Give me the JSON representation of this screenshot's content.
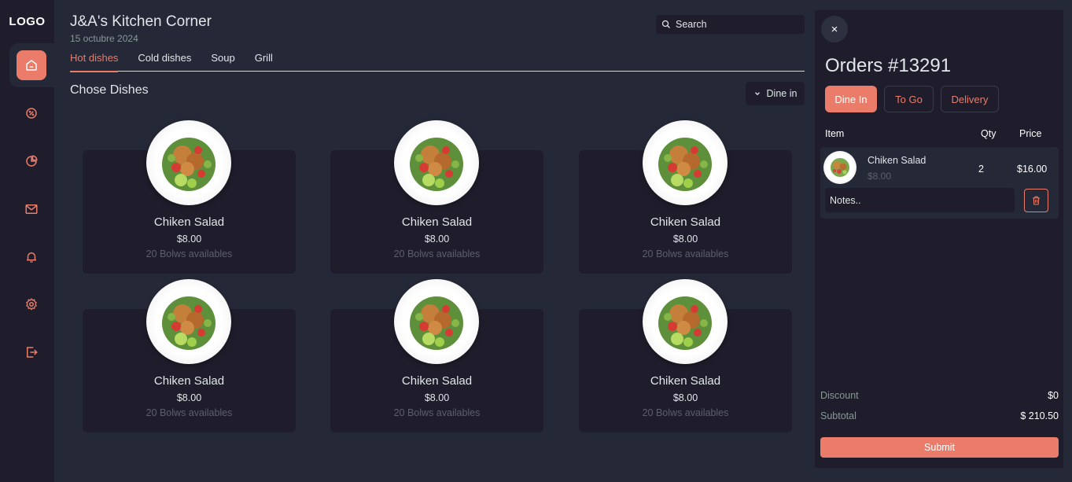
{
  "sidebar": {
    "logo": "LOGO",
    "items": [
      {
        "name": "home"
      },
      {
        "name": "discount"
      },
      {
        "name": "dashboard"
      },
      {
        "name": "messages"
      },
      {
        "name": "notifications"
      },
      {
        "name": "settings"
      },
      {
        "name": "logout"
      }
    ]
  },
  "header": {
    "title": "J&A's Kitchen Corner",
    "date": "15 octubre 2024",
    "search_placeholder": "Search"
  },
  "tabs": [
    "Hot dishes",
    "Cold dishes",
    "Soup",
    "Grill"
  ],
  "main": {
    "section_title": "Chose Dishes",
    "dine_option": "Dine in"
  },
  "dishes": [
    {
      "name": "Chiken Salad",
      "price": "$8.00",
      "availability": "20 Bolws availables"
    },
    {
      "name": "Chiken Salad",
      "price": "$8.00",
      "availability": "20 Bolws availables"
    },
    {
      "name": "Chiken Salad",
      "price": "$8.00",
      "availability": "20 Bolws availables"
    },
    {
      "name": "Chiken Salad",
      "price": "$8.00",
      "availability": "20 Bolws availables"
    },
    {
      "name": "Chiken Salad",
      "price": "$8.00",
      "availability": "20 Bolws availables"
    },
    {
      "name": "Chiken Salad",
      "price": "$8.00",
      "availability": "20 Bolws availables"
    }
  ],
  "orders": {
    "close_label": "×",
    "title": "Orders #13291",
    "types": [
      "Dine In",
      "To Go",
      "Delivery"
    ],
    "columns": {
      "item": "Item",
      "qty": "Qty",
      "price": "Price"
    },
    "items": [
      {
        "name": "Chiken Salad",
        "unit_price": "$8.00",
        "qty": "2",
        "total": "$16.00",
        "notes_placeholder": "Notes.."
      }
    ],
    "discount_label": "Discount",
    "discount_value": "$0",
    "subtotal_label": "Subtotal",
    "subtotal_value": "$ 210.50",
    "submit_label": "Submit"
  },
  "colors": {
    "accent": "#ea7c69",
    "background": "#252836",
    "panel": "#1f1d2b"
  }
}
